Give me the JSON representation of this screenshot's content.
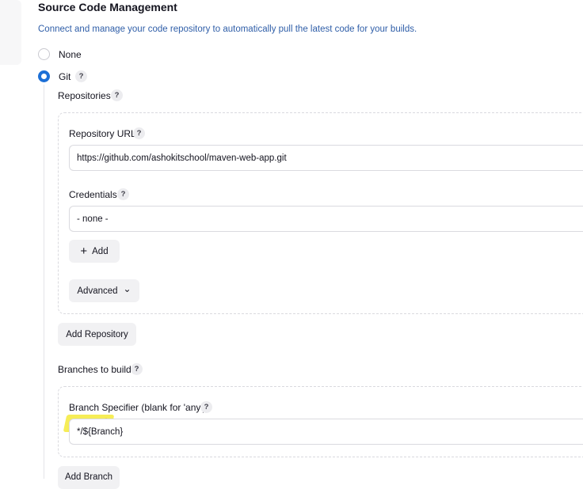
{
  "section": {
    "title": "Source Code Management",
    "description": "Connect and manage your code repository to automatically pull the latest code for your builds."
  },
  "scm_options": {
    "none_label": "None",
    "git_label": "Git",
    "selected": "Git"
  },
  "help_glyph": "?",
  "repositories": {
    "label": "Repositories",
    "url_label": "Repository URL",
    "url_value": "https://github.com/ashokitschool/maven-web-app.git",
    "credentials_label": "Credentials",
    "credentials_value": "- none -",
    "add_label": "Add",
    "add_icon": "+",
    "advanced_label": "Advanced",
    "advanced_icon": "⌄",
    "add_repository_label": "Add Repository"
  },
  "branches": {
    "label": "Branches to build",
    "specifier_label": "Branch Specifier (blank for 'any')",
    "specifier_value": "*/${Branch}",
    "add_branch_label": "Add Branch"
  },
  "colors": {
    "accent": "#1c6fd6",
    "description_text": "#2f5ea8",
    "highlight_yellow": "#f5ea3a",
    "annotation_red": "#c92b2b"
  }
}
